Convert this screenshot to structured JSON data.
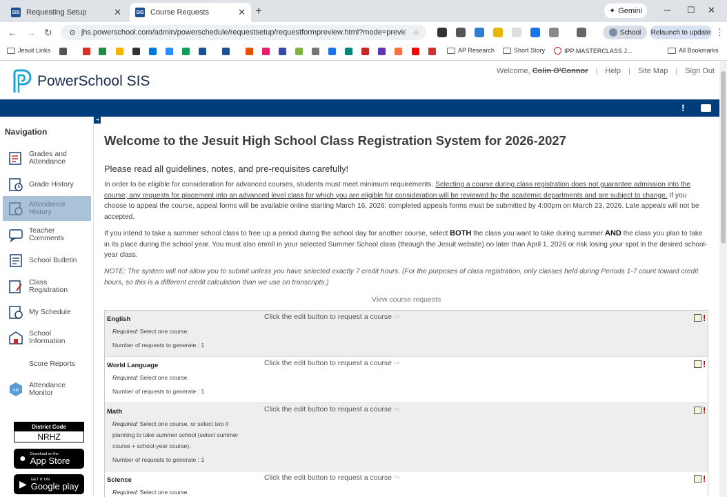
{
  "browser": {
    "tabs": [
      {
        "label": "Requesting Setup",
        "active": false
      },
      {
        "label": "Course Requests",
        "active": true
      }
    ],
    "gemini_label": "Gemini",
    "url": "jhs.powerschool.com/admin/powerschedule/requestsetup/requestformpreview.html?mode=previe...",
    "profile_label": "School",
    "relaunch_label": "Relaunch to update",
    "bookmarks": [
      {
        "label": "Jesuit Links",
        "type": "folder"
      },
      {
        "label": "AP Research",
        "type": "folder"
      },
      {
        "label": "Short Story",
        "type": "folder"
      },
      {
        "label": "IPP MASTERCLASS J...",
        "type": "link"
      },
      {
        "label": "All Bookmarks",
        "type": "folder"
      }
    ]
  },
  "header": {
    "logo_text": "PowerSchool SIS",
    "welcome": "Welcome,",
    "user_name": "Colin O'Connor",
    "links": [
      "Help",
      "Site Map",
      "Sign Out"
    ]
  },
  "navigation": {
    "heading": "Navigation",
    "items": [
      {
        "label": "Grades and Attendance",
        "icon": "grades-icon",
        "active": false
      },
      {
        "label": "Grade History",
        "icon": "grade-history-icon",
        "active": false
      },
      {
        "label": "Attendance History",
        "icon": "attendance-history-icon",
        "active": true
      },
      {
        "label": "Teacher Comments",
        "icon": "comments-icon",
        "active": false
      },
      {
        "label": "School Bulletin",
        "icon": "bulletin-icon",
        "active": false
      },
      {
        "label": "Class Registration",
        "icon": "registration-icon",
        "active": false
      },
      {
        "label": "My Schedule",
        "icon": "schedule-icon",
        "active": false
      },
      {
        "label": "School Information",
        "icon": "school-info-icon",
        "active": false
      },
      {
        "label": "Score Reports",
        "icon": "",
        "active": false
      },
      {
        "label": "Attendance Monitor",
        "icon": "attendance-monitor-icon",
        "active": false
      }
    ],
    "district_code_title": "District Code",
    "district_code": "NRHZ",
    "app_store": {
      "small": "Download on the",
      "big": "App Store"
    },
    "google_play": {
      "small": "GET IT ON",
      "big": "Google play"
    }
  },
  "main": {
    "title": "Welcome to the Jesuit High School Class Registration System for 2026-2027",
    "subtitle": "Please read all guidelines, notes, and pre-requisites carefully!",
    "para1_a": "In order to be eligible for consideration for advanced courses, students must meet minimum requirements. ",
    "para1_u": "Selecting a course during class registration does not guarantee admission into the course; any requests for placement into an advanced level class for which you are eligible for consideration will be reviewed by the academic departments and are subject to change.",
    "para1_b": " If you choose to appeal the course, appeal forms will be available online starting March 16, 2026; completed appeals forms must be submitted by 4:00pm on March 23, 2026. Late appeals will not be accepted.",
    "para2_a": "If you intend to take a summer school class to free up a period during the school day for another course, select ",
    "para2_both": "BOTH",
    "para2_b": " the class you want to take during summer ",
    "para2_and": "AND",
    "para2_c": " the class you plan to take in its place during the school year. You must also enroll in your selected Summer School class (through the Jesuit website) no later than April 1, 2026 or risk losing your spot in the desired school-year class.",
    "note": "NOTE: The system will not allow you to submit unless you have selected exactly 7 credit hours. (For the purposes of class registration, only classes held during Periods 1-7 count toward credit hours, so this is a different credit calculation than we use on transcripts.)",
    "view_link": "View course requests",
    "click_msg": "Click the edit button to request a course",
    "required_label": "Required:",
    "rows": [
      {
        "subject": "English",
        "requirement": "Select one course.",
        "generate": "Number of requests to generate : 1"
      },
      {
        "subject": "World Language",
        "requirement": "Select one course.",
        "generate": "Number of requests to generate : 1"
      },
      {
        "subject": "Math",
        "requirement": "Select one course, or select two if planning to take summer school (select summer course + school-year course).",
        "generate": "Number of requests to generate : 1"
      },
      {
        "subject": "Science",
        "requirement": "Select one course.",
        "generate": ""
      }
    ]
  },
  "colors": {
    "brand_blue": "#003d7a",
    "active_nav": "#a9c1d9",
    "alert_red": "#c40000"
  }
}
